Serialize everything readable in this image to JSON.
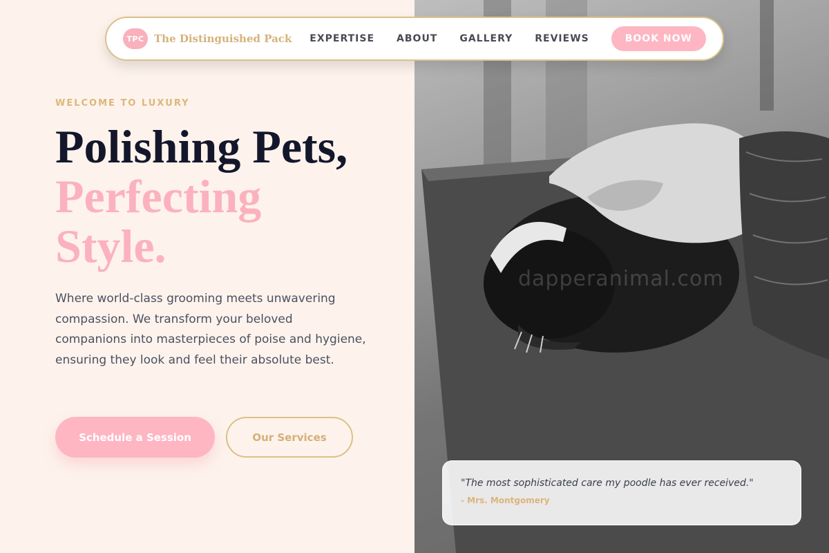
{
  "brand": {
    "badge": "TPC",
    "name": "The Distinguished Pack"
  },
  "nav": {
    "links": [
      "EXPERTISE",
      "ABOUT",
      "GALLERY",
      "REVIEWS"
    ],
    "cta": "BOOK NOW"
  },
  "hero": {
    "eyebrow": "WELCOME TO LUXURY",
    "headline_line1": "Polishing Pets,",
    "headline_line2": "Perfecting",
    "headline_line3": "Style.",
    "description": "Where world-class grooming meets unwavering compassion. We transform your beloved companions into masterpieces of poise and hygiene, ensuring they look and feel their absolute best.",
    "primary_button": "Schedule a Session",
    "secondary_button": "Our Services"
  },
  "image": {
    "watermark": "dapperanimal.com"
  },
  "testimonial": {
    "quote": "\"The most sophisticated care my poodle has ever received.\"",
    "author": "- Mrs. Montgomery"
  },
  "colors": {
    "background": "#fdf3ec",
    "accent_pink": "#fdb6c2",
    "accent_gold": "#dcc089",
    "heading_dark": "#14172b"
  }
}
